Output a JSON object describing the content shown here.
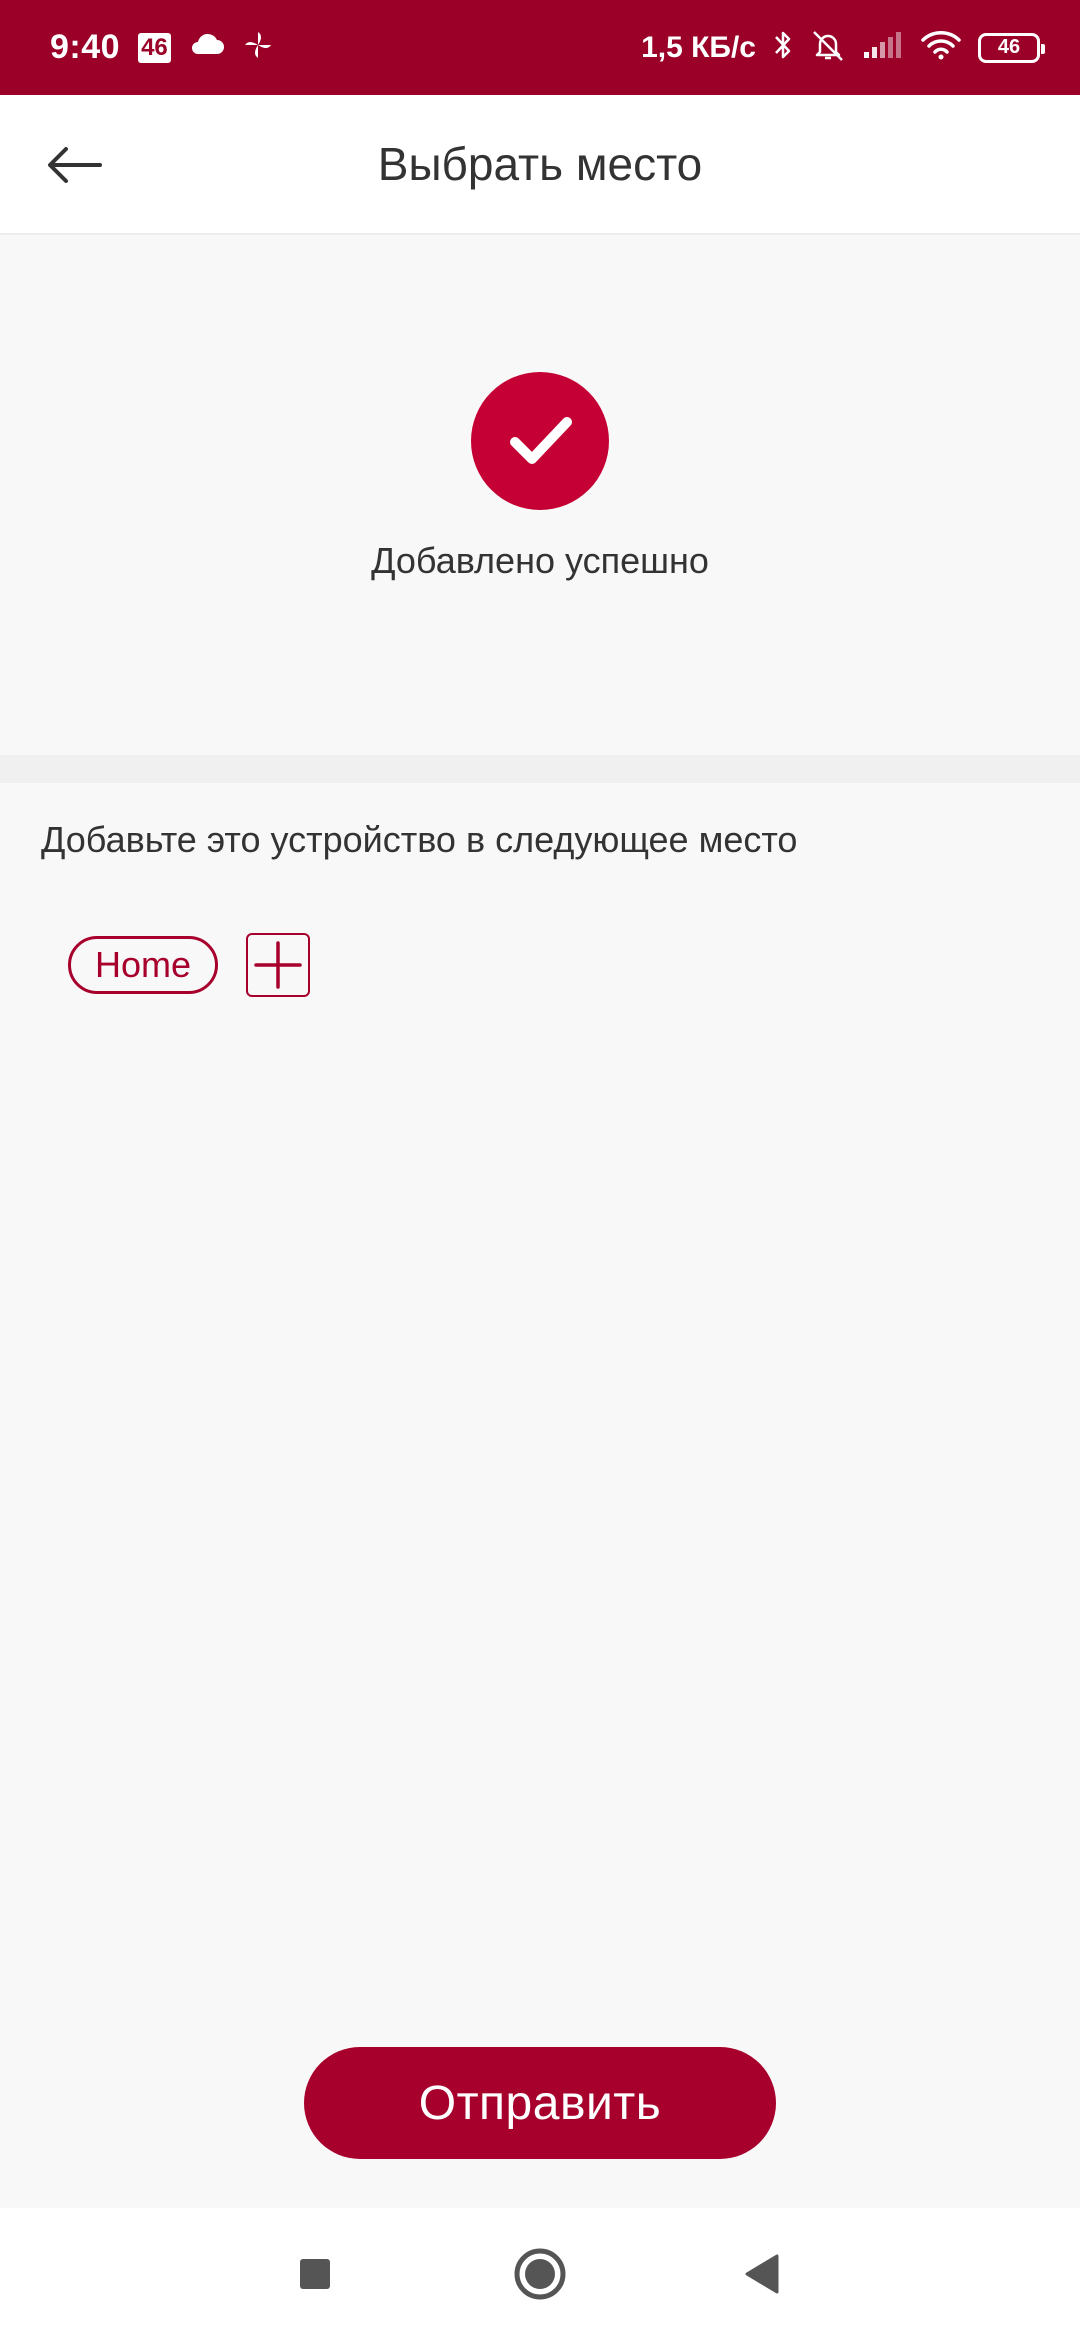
{
  "status_bar": {
    "time": "9:40",
    "network_badge": "46",
    "net_speed": "1,5 КБ/с",
    "battery_level": "46",
    "icons": [
      "cloud-icon",
      "pinwheel-icon",
      "bluetooth-icon",
      "alarm-off-icon",
      "signal-icon",
      "wifi-icon",
      "battery-icon"
    ]
  },
  "app_bar": {
    "title": "Выбрать место"
  },
  "success": {
    "message": "Добавлено успешно"
  },
  "place": {
    "heading": "Добавьте это устройство в следующее место",
    "chips": [
      "Home"
    ]
  },
  "actions": {
    "submit_label": "Отправить"
  },
  "colors": {
    "brand": "#9a0028",
    "accent": "#c40034",
    "chip": "#a8002c",
    "background": "#f8f8f8",
    "text": "#333333"
  }
}
